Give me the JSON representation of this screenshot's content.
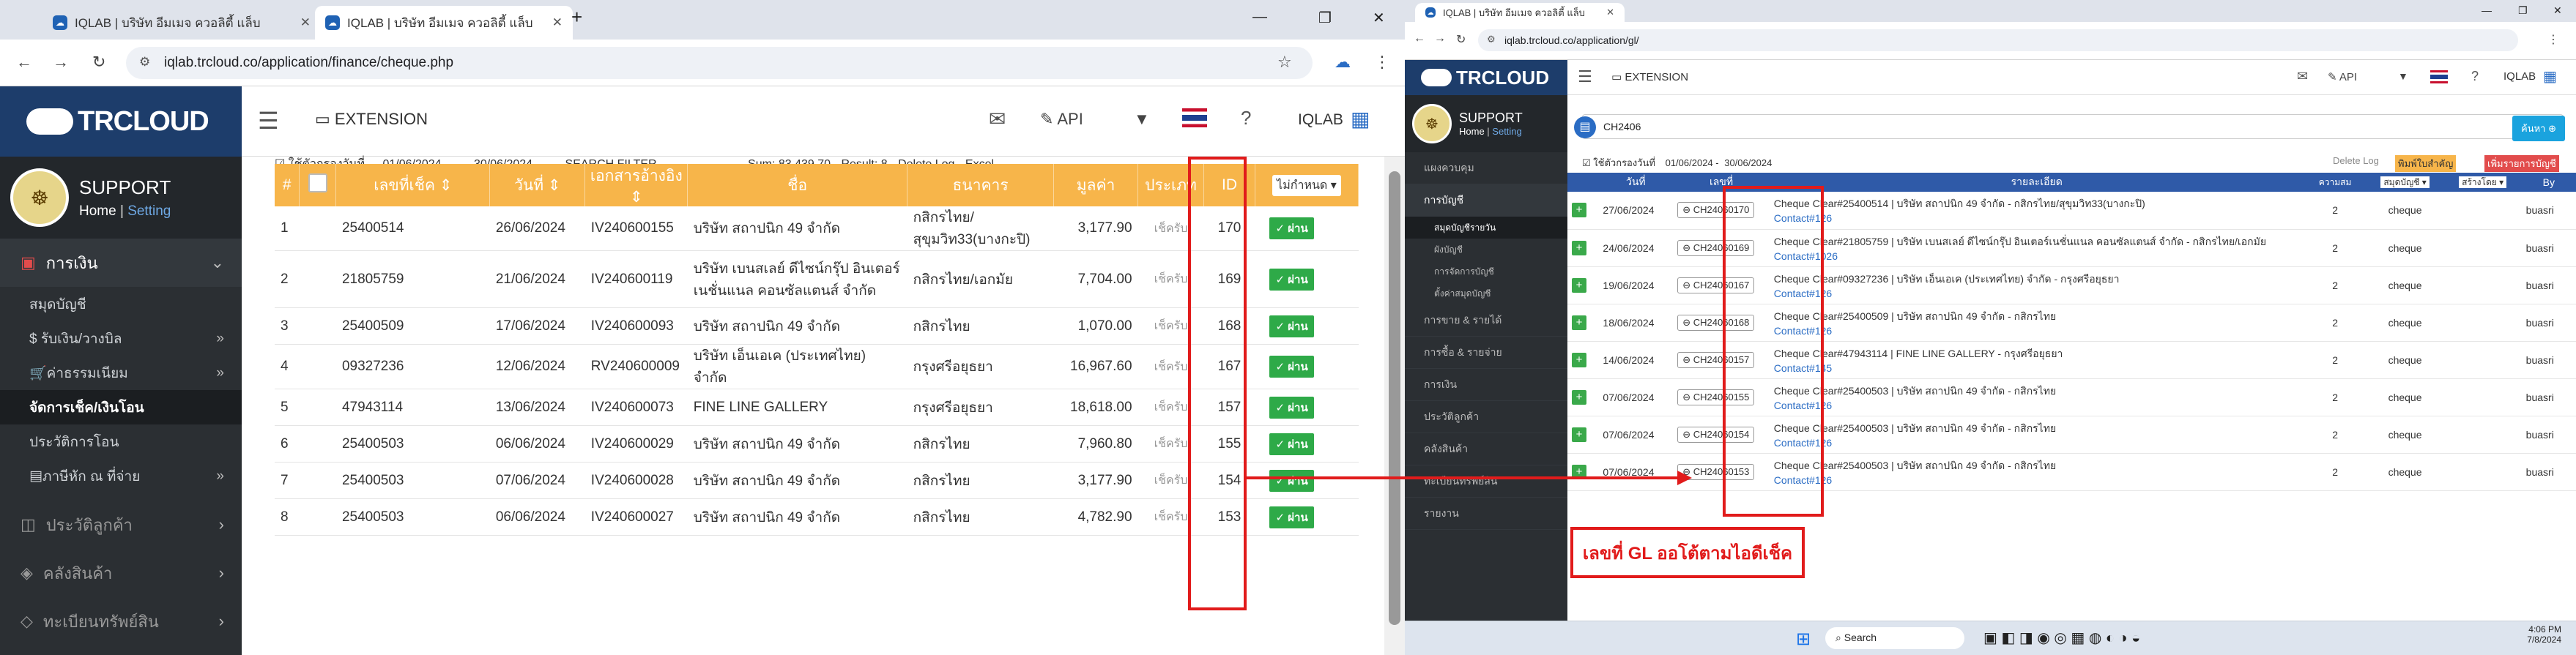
{
  "left": {
    "tabs": [
      {
        "title": "IQLAB | บริษัท อีมเมจ ควอลิตี้ แล็บ",
        "active": false
      },
      {
        "title": "IQLAB | บริษัท อีมเมจ ควอลิตี้ แล็บ",
        "active": true
      }
    ],
    "url": "iqlab.trcloud.co/application/finance/cheque.php",
    "logo": "TRCLOUD",
    "extension": "EXTENSION",
    "api": "API",
    "company": "IQLAB",
    "profile": {
      "name": "SUPPORT",
      "home": "Home",
      "setting": "Setting"
    },
    "section": "การเงิน",
    "menu": [
      "สมุดบัญชี",
      "$ รับเงิน/วางบิล",
      "ค่าธรรมเนียม",
      "จัดการเช็ค/เงินโอน",
      "ประวัติการโอน",
      "ภาษีหัก ณ ที่จ่าย"
    ],
    "groups": [
      "ประวัติลูกค้า",
      "คลังสินค้า",
      "ทะเบียนทรัพย์สิน"
    ],
    "filter": {
      "label": "ใช้ตัวกรองวันที่",
      "from": "01/06/2024",
      "to": "30/06/2024",
      "btn": "SEARCH FILTER",
      "sum": "Sum: 83,439.70",
      "result": "Result: 8",
      "log": "Delete Log",
      "excel": "Excel"
    },
    "columns": [
      "#",
      "",
      "เลขที่เช็ค",
      "วันที่",
      "เอกสารอ้างอิง",
      "ชื่อ",
      "ธนาคาร",
      "มูลค่า",
      "ประเภท",
      "ID",
      "ไม่กำหนด"
    ],
    "rows": [
      {
        "n": "1",
        "cheque": "25400514",
        "date": "26/06/2024",
        "ref": "IV240600155",
        "name": "บริษัท สถาปนิก 49 จำกัด",
        "bank": "กสิกรไทย/สุขุมวิท33(บางกะปิ)",
        "amount": "3,177.90",
        "type": "เช็ครับ",
        "id": "170",
        "action": "ผ่าน"
      },
      {
        "n": "2",
        "cheque": "21805759",
        "date": "21/06/2024",
        "ref": "IV240600119",
        "name": "บริษัท เบนสเลย์ ดีไซน์กรุ๊ป อินเตอร์เนชั่นแนล คอนซัลแตนส์ จำกัด",
        "bank": "กสิกรไทย/เอกมัย",
        "amount": "7,704.00",
        "type": "เช็ครับ",
        "id": "169",
        "action": "ผ่าน"
      },
      {
        "n": "3",
        "cheque": "25400509",
        "date": "17/06/2024",
        "ref": "IV240600093",
        "name": "บริษัท สถาปนิก 49 จำกัด",
        "bank": "กสิกรไทย",
        "amount": "1,070.00",
        "type": "เช็ครับ",
        "id": "168",
        "action": "ผ่าน"
      },
      {
        "n": "4",
        "cheque": "09327236",
        "date": "12/06/2024",
        "ref": "RV240600009",
        "name": "บริษัท เอ็นเอเค (ประเทศไทย) จำกัด",
        "bank": "กรุงศรีอยุธยา",
        "amount": "16,967.60",
        "type": "เช็ครับ",
        "id": "167",
        "action": "ผ่าน"
      },
      {
        "n": "5",
        "cheque": "47943114",
        "date": "13/06/2024",
        "ref": "IV240600073",
        "name": "FINE LINE GALLERY",
        "bank": "กรุงศรีอยุธยา",
        "amount": "18,618.00",
        "type": "เช็ครับ",
        "id": "157",
        "action": "ผ่าน"
      },
      {
        "n": "6",
        "cheque": "25400503",
        "date": "06/06/2024",
        "ref": "IV240600029",
        "name": "บริษัท สถาปนิก 49 จำกัด",
        "bank": "กสิกรไทย",
        "amount": "7,960.80",
        "type": "เช็ครับ",
        "id": "155",
        "action": "ผ่าน"
      },
      {
        "n": "7",
        "cheque": "25400503",
        "date": "07/06/2024",
        "ref": "IV240600028",
        "name": "บริษัท สถาปนิก 49 จำกัด",
        "bank": "กสิกรไทย",
        "amount": "3,177.90",
        "type": "เช็ครับ",
        "id": "154",
        "action": "ผ่าน"
      },
      {
        "n": "8",
        "cheque": "25400503",
        "date": "06/06/2024",
        "ref": "IV240600027",
        "name": "บริษัท สถาปนิก 49 จำกัด",
        "bank": "กสิกรไทย",
        "amount": "4,782.90",
        "type": "เช็ครับ",
        "id": "153",
        "action": "ผ่าน"
      }
    ]
  },
  "right": {
    "tab": "IQLAB | บริษัท อีมเมจ ควอลิตี้ แล็บ",
    "url": "iqlab.trcloud.co/application/gl/",
    "logo": "TRCLOUD",
    "extension": "EXTENSION",
    "api": "API",
    "company": "IQLAB",
    "profile": {
      "name": "SUPPORT",
      "home": "Home",
      "setting": "Setting"
    },
    "search": "CH2406",
    "search_btn": "ค้นหา",
    "menu": [
      "แผงควบคุม",
      "การบัญชี",
      "สมุดบัญชีรายวัน",
      "ผังบัญชี",
      "การจัดการบัญชี",
      "ตั้งค่าสมุดบัญชี",
      "การขาย & รายได้",
      "การซื้อ & รายจ่าย",
      "การเงิน",
      "ประวัติลูกค้า",
      "คลังสินค้า",
      "ทะเบียนทรัพย์สิน",
      "รายงาน"
    ],
    "filter": {
      "label": "ใช้ตัวกรองวันที่",
      "from": "01/06/2024",
      "to": "30/06/2024",
      "log": "Delete Log",
      "btn1": "พิมพ์ใบสำคัญ",
      "btn2": "เพิ่มรายการบัญชี"
    },
    "columns": [
      "",
      "วันที่",
      "เลขที่",
      "รายละเอียด",
      "ความสม",
      "สมุดบัญชี",
      "สร้างโดย",
      "By"
    ],
    "rows": [
      {
        "date": "27/06/2024",
        "gl": "CH24060170",
        "desc": "Cheque Clear#25400514 | บริษัท สถาปนิก 49 จำกัด - กสิกรไทย/สุขุมวิท33(บางกะปิ)",
        "contact": "Contact#126",
        "n": "2",
        "book": "cheque",
        "by": "buasri"
      },
      {
        "date": "24/06/2024",
        "gl": "CH24060169",
        "desc": "Cheque Clear#21805759 | บริษัท เบนสเลย์ ดีไซน์กรุ๊ป อินเตอร์เนชั่นแนล คอนซัลแตนส์ จำกัด - กสิกรไทย/เอกมัย",
        "contact": "Contact#1026",
        "n": "2",
        "book": "cheque",
        "by": "buasri"
      },
      {
        "date": "19/06/2024",
        "gl": "CH24060167",
        "desc": "Cheque Clear#09327236 | บริษัท เอ็นเอเค (ประเทศไทย) จำกัด - กรุงศรีอยุธยา",
        "contact": "Contact#126",
        "n": "2",
        "book": "cheque",
        "by": "buasri"
      },
      {
        "date": "18/06/2024",
        "gl": "CH24060168",
        "desc": "Cheque Clear#25400509 | บริษัท สถาปนิก 49 จำกัด - กสิกรไทย",
        "contact": "Contact#126",
        "n": "2",
        "book": "cheque",
        "by": "buasri"
      },
      {
        "date": "14/06/2024",
        "gl": "CH24060157",
        "desc": "Cheque Clear#47943114 | FINE LINE GALLERY - กรุงศรีอยุธยา",
        "contact": "Contact#145",
        "n": "2",
        "book": "cheque",
        "by": "buasri"
      },
      {
        "date": "07/06/2024",
        "gl": "CH24060155",
        "desc": "Cheque Clear#25400503 | บริษัท สถาปนิก 49 จำกัด - กสิกรไทย",
        "contact": "Contact#126",
        "n": "2",
        "book": "cheque",
        "by": "buasri"
      },
      {
        "date": "07/06/2024",
        "gl": "CH24060154",
        "desc": "Cheque Clear#25400503 | บริษัท สถาปนิก 49 จำกัด - กสิกรไทย",
        "contact": "Contact#126",
        "n": "2",
        "book": "cheque",
        "by": "buasri"
      },
      {
        "date": "07/06/2024",
        "gl": "CH24060153",
        "desc": "Cheque Clear#25400503 | บริษัท สถาปนิก 49 จำกัด - กสิกรไทย",
        "contact": "Contact#126",
        "n": "2",
        "book": "cheque",
        "by": "buasri"
      }
    ],
    "callout": "เลขที่ GL ออโต้ตามไอดีเช็ค",
    "taskbar": {
      "search": "Search",
      "time": "4:06 PM",
      "date": "7/8/2024"
    }
  }
}
